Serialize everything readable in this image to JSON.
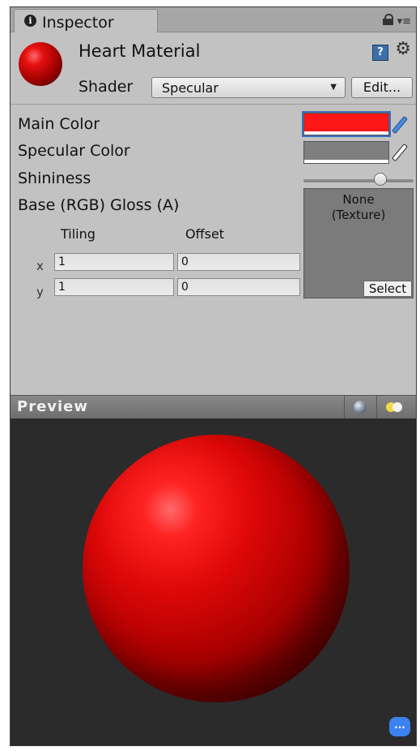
{
  "window": {
    "tab_title": "Inspector",
    "tab_icon": "info-icon",
    "lock_icon": "lock-icon",
    "menu_icon": "tab-menu-icon"
  },
  "material": {
    "name": "Heart Material",
    "shader_label": "Shader",
    "shader_value": "Specular",
    "edit_label": "Edit...",
    "help_icon": "help-icon",
    "settings_icon": "gear-icon"
  },
  "properties": {
    "main_color_label": "Main Color",
    "main_color": "#ff1616",
    "specular_color_label": "Specular Color",
    "specular_color": "#7f7f7f",
    "shininess_label": "Shininess",
    "shininess_value": 0.7,
    "texture_label": "Base (RGB) Gloss (A)",
    "texture_none": "None\n(Texture)",
    "texture_select": "Select",
    "tiling_label": "Tiling",
    "offset_label": "Offset",
    "x_label": "x",
    "y_label": "y",
    "tiling_x": "1",
    "tiling_y": "1",
    "offset_x": "0",
    "offset_y": "0"
  },
  "preview": {
    "title": "Preview",
    "sphere_icon": "preview-mesh-sphere-icon",
    "light_icon": "preview-lighting-icon",
    "sphere_color": "#e00808",
    "chat_icon": "chat-bubble-icon",
    "chat_text": "..."
  }
}
